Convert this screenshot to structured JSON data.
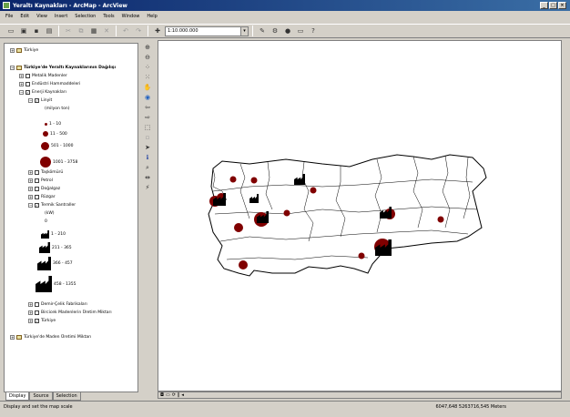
{
  "window": {
    "title": "Yeraltı Kaynakları - ArcMap - ArcView",
    "min": "_",
    "max": "□",
    "close": "×"
  },
  "menu": [
    "File",
    "Edit",
    "View",
    "Insert",
    "Selection",
    "Tools",
    "Window",
    "Help"
  ],
  "toolbar": {
    "scale": "1:10.000.000"
  },
  "toc": {
    "layer_turkiye_top": "Türkiye",
    "dataframe": "Türkiye'de Yeraltı Kaynaklarının Dağılışı",
    "metalik": "Metalik Madenler",
    "endustri": "Endüstri Hammaddeleri",
    "enerji": "Enerji Kaynakları",
    "linyit": "Linyit",
    "linyit_unit": "(milyon ton)",
    "linyit_classes": [
      "1 - 10",
      "11 - 500",
      "501 - 1000",
      "1001 - 3758"
    ],
    "taskomuru": "Taşkömürü",
    "petrol": "Petrol",
    "dogalgaz": "Doğalgaz",
    "rulzgar": "Rüzgar",
    "termik": "Termik Santraller",
    "termik_unit": "(kW)",
    "termik_zero": "0",
    "termik_classes": [
      "1 - 210",
      "211 - 365",
      "366 - 457",
      "458 - 1355"
    ],
    "demir": "Demir-Çelik Fabrikaları",
    "bircicek": "Bircicek Madenlerin Üretim Miktarı",
    "turkiye_layer": "Türkiye",
    "uretim": "Türkiye'de Maden Üretimi Miktarı"
  },
  "tabs": [
    "Display",
    "Source",
    "Selection"
  ],
  "status": {
    "left": "Display and set the map scale",
    "coords": "6047,648  5263716,545 Meters"
  },
  "colors": {
    "symbol": "#800000"
  }
}
